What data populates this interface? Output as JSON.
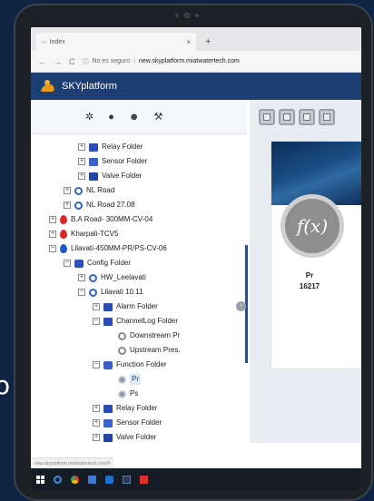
{
  "background_letter": "o",
  "browser": {
    "tab_title": "Index",
    "tab_close": "×",
    "new_tab": "+",
    "nav": {
      "back": "←",
      "forward": "→",
      "reload": "C"
    },
    "security_label": "No es seguro",
    "url": "new.skyplatform.miatwatertech.com"
  },
  "app": {
    "title": "SKYplatform"
  },
  "toolbar": {
    "icons": [
      "gear-icon",
      "drop-icon",
      "users-icon",
      "wrench-icon"
    ],
    "glyphs": {
      "gear": "✲",
      "drop": "●",
      "users": "☻",
      "wrench": "⚒"
    }
  },
  "tree": {
    "nodes": [
      {
        "label": "Relay Folder",
        "depth": 5,
        "icon": "folder",
        "exp": "+"
      },
      {
        "label": "Sensor Folder",
        "depth": 5,
        "icon": "folder-sensor",
        "exp": "+"
      },
      {
        "label": "Valve Folder",
        "depth": 5,
        "icon": "folder-valve",
        "exp": "+"
      },
      {
        "label": "NL Road",
        "depth": 4,
        "icon": "ring",
        "exp": "+"
      },
      {
        "label": "NL Road 27.08",
        "depth": 4,
        "icon": "ring",
        "exp": "+"
      },
      {
        "label": "B.A Road- 300MM-CV-04",
        "depth": 3,
        "icon": "drop-red",
        "exp": "+"
      },
      {
        "label": "Kharpali-TCV5",
        "depth": 3,
        "icon": "drop-red",
        "exp": "+"
      },
      {
        "label": "Lilavati-450MM-PR/PS-CV-06",
        "depth": 3,
        "icon": "drop-blue",
        "exp": "−"
      },
      {
        "label": "Config Folder",
        "depth": 4,
        "icon": "config",
        "exp": "−"
      },
      {
        "label": "HW_Leelavati",
        "depth": 5,
        "icon": "ring",
        "exp": "+"
      },
      {
        "label": "Lilavati 10.11",
        "depth": 5,
        "icon": "ring",
        "exp": "−"
      },
      {
        "label": "Alarm Folder",
        "depth": 6,
        "icon": "folder",
        "exp": "+"
      },
      {
        "label": "ChannelLog Folder",
        "depth": 6,
        "icon": "folder",
        "exp": "−"
      },
      {
        "label": "Downstream Pr",
        "depth": 7,
        "icon": "ring-grey",
        "exp": ""
      },
      {
        "label": "Upstream Pres.",
        "depth": 7,
        "icon": "ring-grey",
        "exp": ""
      },
      {
        "label": "Function Folder",
        "depth": 6,
        "icon": "fx",
        "exp": "−"
      },
      {
        "label": "Pr",
        "depth": 7,
        "icon": "gear",
        "exp": "",
        "selected": true
      },
      {
        "label": "Ps",
        "depth": 7,
        "icon": "gear",
        "exp": ""
      },
      {
        "label": "Relay Folder",
        "depth": 6,
        "icon": "folder",
        "exp": "+"
      },
      {
        "label": "Sensor Folder",
        "depth": 6,
        "icon": "folder-sensor",
        "exp": "+"
      },
      {
        "label": "Valve Folder",
        "depth": 6,
        "icon": "folder-valve",
        "exp": "+"
      }
    ]
  },
  "collapse_toggle": "‹",
  "view_buttons": [
    "home-view-icon",
    "grid-view-icon",
    "document-view-icon",
    "list-view-icon"
  ],
  "card": {
    "icon_text": "f(x)",
    "name": "Pr",
    "value": "16217"
  },
  "status_url": "new.skyplatform.miatwatertech.com/#",
  "taskbar": [
    "windows-icon",
    "ie-icon",
    "chrome-icon",
    "store-icon",
    "mail-icon",
    "database-icon",
    "app-red-icon"
  ]
}
